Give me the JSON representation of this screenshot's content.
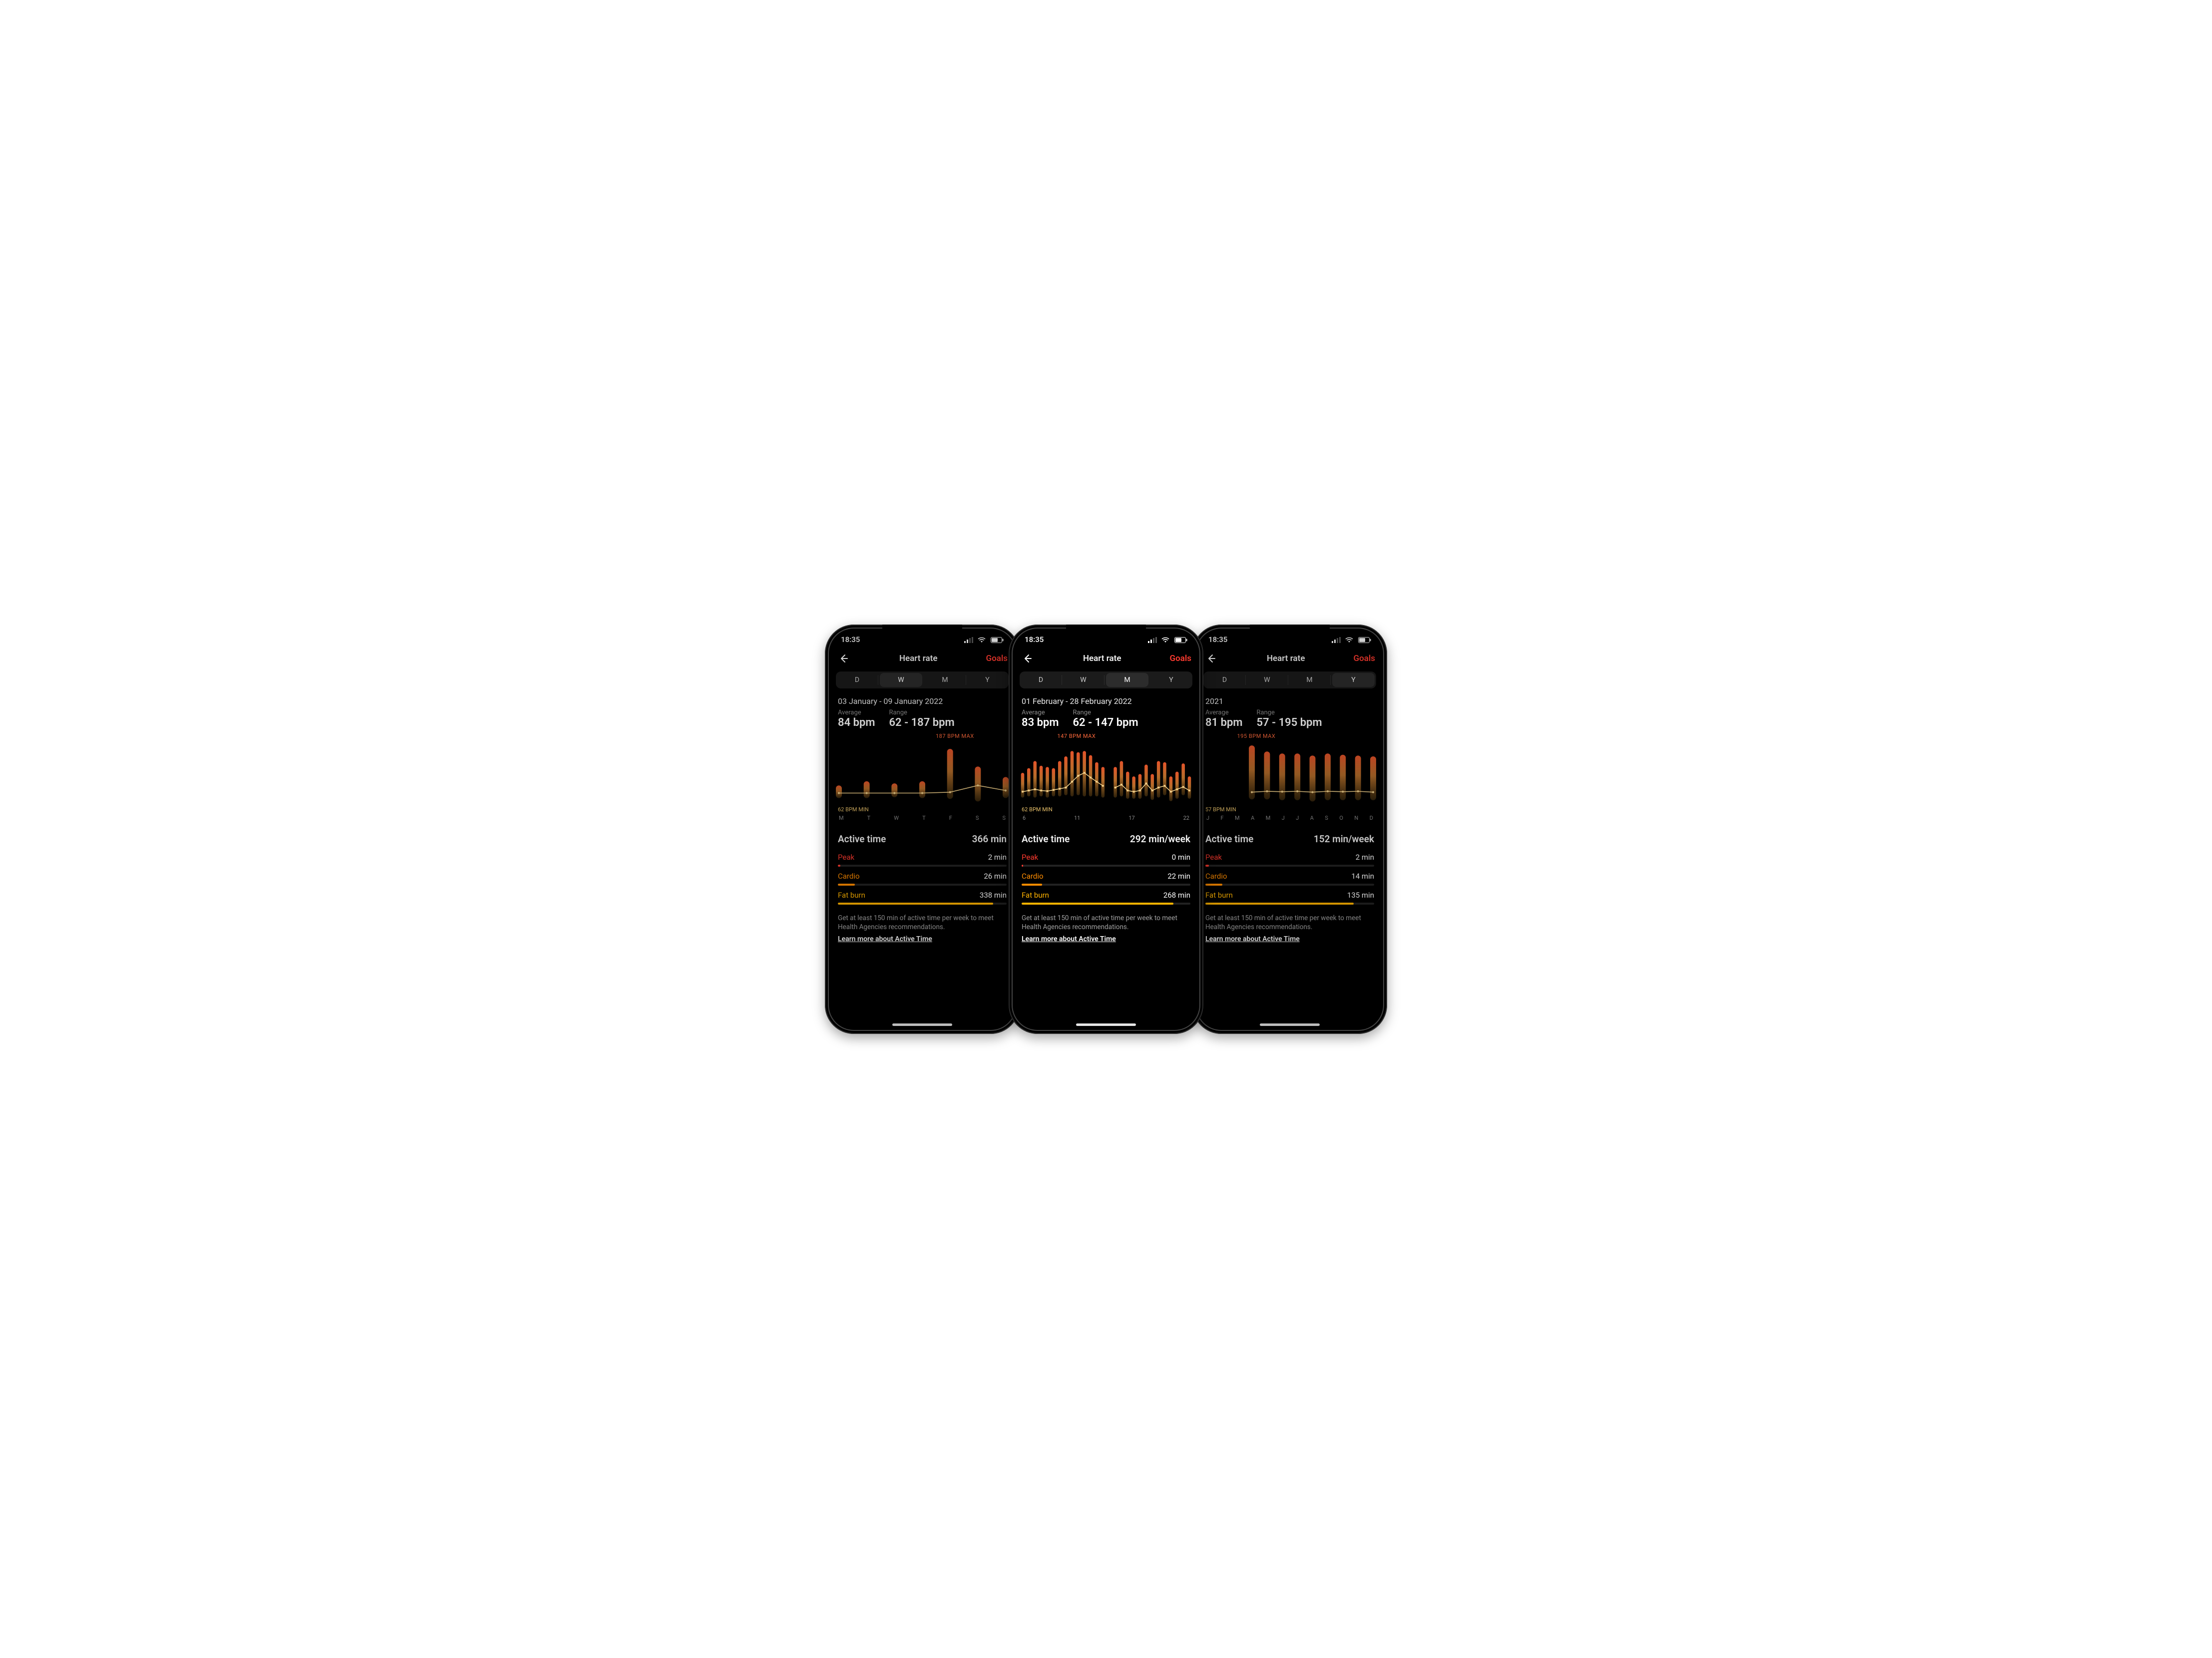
{
  "status_time": "18:35",
  "nav": {
    "title": "Heart rate",
    "goals": "Goals"
  },
  "segments": [
    "D",
    "W",
    "M",
    "Y"
  ],
  "active_section_title": "Active time",
  "note": "Get at least 150 min of active time per week to meet Health Agencies recommendations.",
  "learn_more": "Learn more about Active Time",
  "screens": [
    {
      "key": "week",
      "active_segment": "W",
      "date_range": "03 January - 09 January 2022",
      "average_label": "Average",
      "average_value": "84 bpm",
      "range_label": "Range",
      "range_value": "62 - 187 bpm",
      "max_label": "187 BPM MAX",
      "min_label": "62 BPM MIN",
      "x_ticks": [
        "M",
        "T",
        "W",
        "T",
        "F",
        "S",
        "S"
      ],
      "active_time_value": "366 min",
      "rows": {
        "peak": {
          "label": "Peak",
          "value": "2 min",
          "pct": 1.5
        },
        "cardio": {
          "label": "Cardio",
          "value": "26 min",
          "pct": 10
        },
        "fatburn": {
          "label": "Fat burn",
          "value": "338 min",
          "pct": 92
        }
      },
      "chart_data": {
        "type": "line+bar",
        "ylim": [
          60,
          200
        ],
        "categories": [
          "M",
          "T",
          "W",
          "T",
          "F",
          "S",
          "S"
        ],
        "series": [
          {
            "name": "avg",
            "type": "line",
            "values": [
              82,
              82,
              82,
              82,
              84,
              100,
              88
            ]
          },
          {
            "name": "range_low",
            "type": "bar-low",
            "values": [
              70,
              70,
              72,
              70,
              68,
              62,
              70
            ]
          },
          {
            "name": "range_high",
            "type": "bar-high",
            "values": [
              100,
              110,
              105,
              110,
              187,
              145,
              120
            ]
          }
        ]
      }
    },
    {
      "key": "month",
      "active_segment": "M",
      "date_range": "01 February - 28 February 2022",
      "average_label": "Average",
      "average_value": "83 bpm",
      "range_label": "Range",
      "range_value": "62 - 147 bpm",
      "max_label": "147 BPM MAX",
      "min_label": "62 BPM MIN",
      "x_ticks": [
        "6",
        "11",
        "17",
        "22"
      ],
      "active_time_value": "292 min/week",
      "rows": {
        "peak": {
          "label": "Peak",
          "value": "0 min",
          "pct": 0.8
        },
        "cardio": {
          "label": "Cardio",
          "value": "22 min",
          "pct": 12
        },
        "fatburn": {
          "label": "Fat burn",
          "value": "268 min",
          "pct": 90
        }
      },
      "chart_data": {
        "type": "line+bar",
        "ylim": [
          60,
          160
        ],
        "x": [
          1,
          2,
          3,
          4,
          5,
          6,
          7,
          8,
          9,
          10,
          11,
          12,
          13,
          14,
          15,
          16,
          17,
          18,
          19,
          20,
          21,
          22,
          23,
          24,
          25,
          26,
          27,
          28
        ],
        "series": [
          {
            "name": "avg",
            "type": "line",
            "values": [
              78,
              80,
              82,
              80,
              79,
              81,
              83,
              85,
              95,
              105,
              110,
              102,
              95,
              88,
              null,
              85,
              90,
              80,
              78,
              80,
              92,
              80,
              85,
              88,
              78,
              82,
              86,
              80
            ]
          },
          {
            "name": "range_low",
            "type": "bar-low",
            "values": [
              68,
              70,
              68,
              70,
              68,
              70,
              70,
              72,
              70,
              72,
              70,
              70,
              70,
              68,
              null,
              68,
              70,
              66,
              66,
              66,
              70,
              64,
              68,
              72,
              62,
              66,
              72,
              66
            ]
          },
          {
            "name": "range_high",
            "type": "bar-high",
            "values": [
              110,
              118,
              130,
              122,
              120,
              118,
              130,
              138,
              147,
              145,
              147,
              140,
              128,
              120,
              null,
              120,
              130,
              112,
              104,
              108,
              124,
              108,
              130,
              128,
              104,
              112,
              126,
              104
            ]
          }
        ]
      }
    },
    {
      "key": "year",
      "active_segment": "Y",
      "date_range": "2021",
      "average_label": "Average",
      "average_value": "81 bpm",
      "range_label": "Range",
      "range_value": "57 - 195 bpm",
      "max_label": "195 BPM MAX",
      "min_label": "57 BPM MIN",
      "x_ticks": [
        "J",
        "F",
        "M",
        "A",
        "M",
        "J",
        "J",
        "A",
        "S",
        "O",
        "N",
        "D"
      ],
      "active_time_value": "152 min/week",
      "rows": {
        "peak": {
          "label": "Peak",
          "value": "2 min",
          "pct": 2
        },
        "cardio": {
          "label": "Cardio",
          "value": "14 min",
          "pct": 10
        },
        "fatburn": {
          "label": "Fat burn",
          "value": "135 min",
          "pct": 88
        }
      },
      "chart_data": {
        "type": "line+bar",
        "ylim": [
          55,
          200
        ],
        "categories": [
          "J",
          "F",
          "M",
          "A",
          "M",
          "J",
          "J",
          "A",
          "S",
          "O",
          "N",
          "D"
        ],
        "series": [
          {
            "name": "avg",
            "type": "line",
            "values": [
              null,
              null,
              null,
              80,
              82,
              81,
              82,
              80,
              82,
              81,
              82,
              80
            ]
          },
          {
            "name": "range_low",
            "type": "bar-low",
            "values": [
              null,
              null,
              null,
              62,
              62,
              60,
              60,
              57,
              60,
              60,
              60,
              60
            ]
          },
          {
            "name": "range_high",
            "type": "bar-high",
            "values": [
              null,
              null,
              null,
              195,
              180,
              175,
              175,
              170,
              175,
              172,
              170,
              168
            ]
          }
        ]
      }
    }
  ]
}
